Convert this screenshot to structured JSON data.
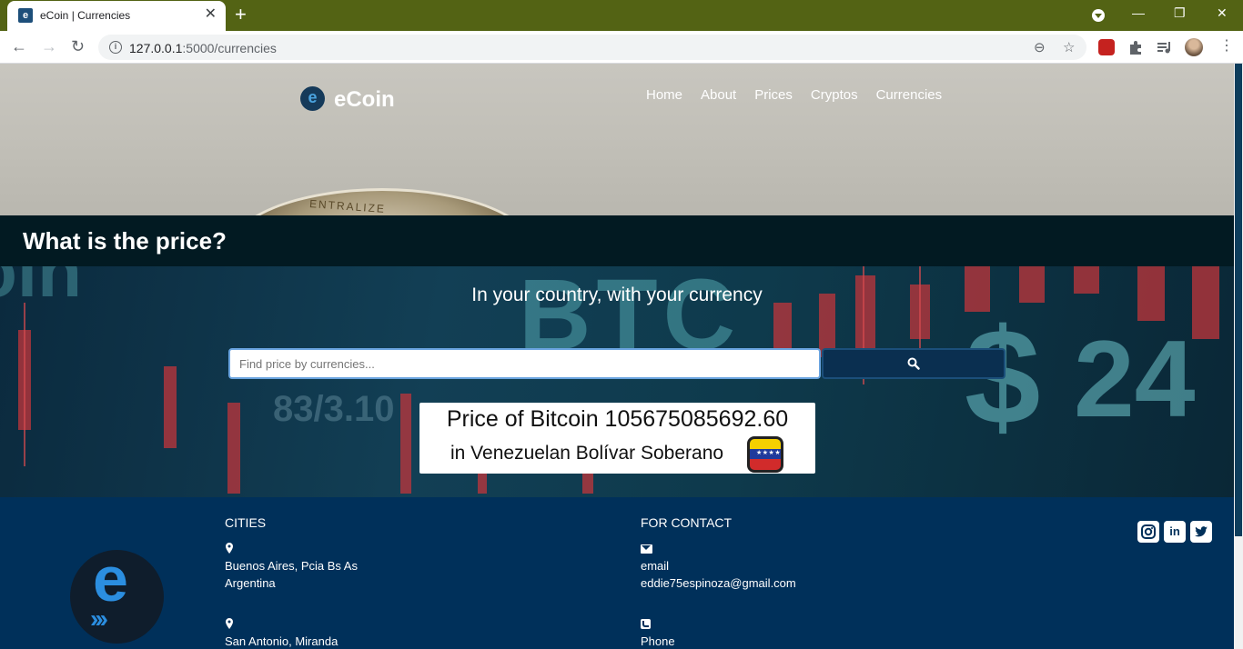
{
  "browser": {
    "tab_title": "eCoin | Currencies",
    "tab_favicon_letter": "e",
    "url_host": "127.0.0.1",
    "url_rest": ":5000/currencies"
  },
  "header": {
    "brand": "eCoin",
    "logo_letter": "e",
    "nav": [
      "Home",
      "About",
      "Prices",
      "Cryptos",
      "Currencies"
    ]
  },
  "banner": {
    "title": "What is the price?"
  },
  "search": {
    "subtitle": "In your country, with your currency",
    "placeholder": "Find price by currencies..."
  },
  "result": {
    "line1": "Price of Bitcoin 105675085692.60",
    "line2": "in Venezuelan Bolívar Soberano"
  },
  "hero": {
    "coin_engraving": "ENTRALIZE"
  },
  "market_bg": {
    "btc_text": "BTC",
    "dollar_text": "$",
    "number_text": "24",
    "left_text": "oin",
    "ticker_text": "83/3.10"
  },
  "footer": {
    "logo_letter": "e",
    "logo_arrows": "›››",
    "cities_heading": "CITIES",
    "city1_line1": "Buenos Aires, Pcia Bs As",
    "city1_line2": "Argentina",
    "city2_line1": "San Antonio, Miranda",
    "contact_heading": "FOR CONTACT",
    "email_label": "email",
    "email_value": "eddie75espinoza@gmail.com",
    "phone_label": "Phone",
    "social": [
      "instagram",
      "linkedin",
      "twitter"
    ]
  },
  "colors": {
    "chrome_frame": "#536314",
    "banner_bg": "#021a22",
    "footer_bg": "#00305a",
    "search_button": "#0a2f50"
  }
}
